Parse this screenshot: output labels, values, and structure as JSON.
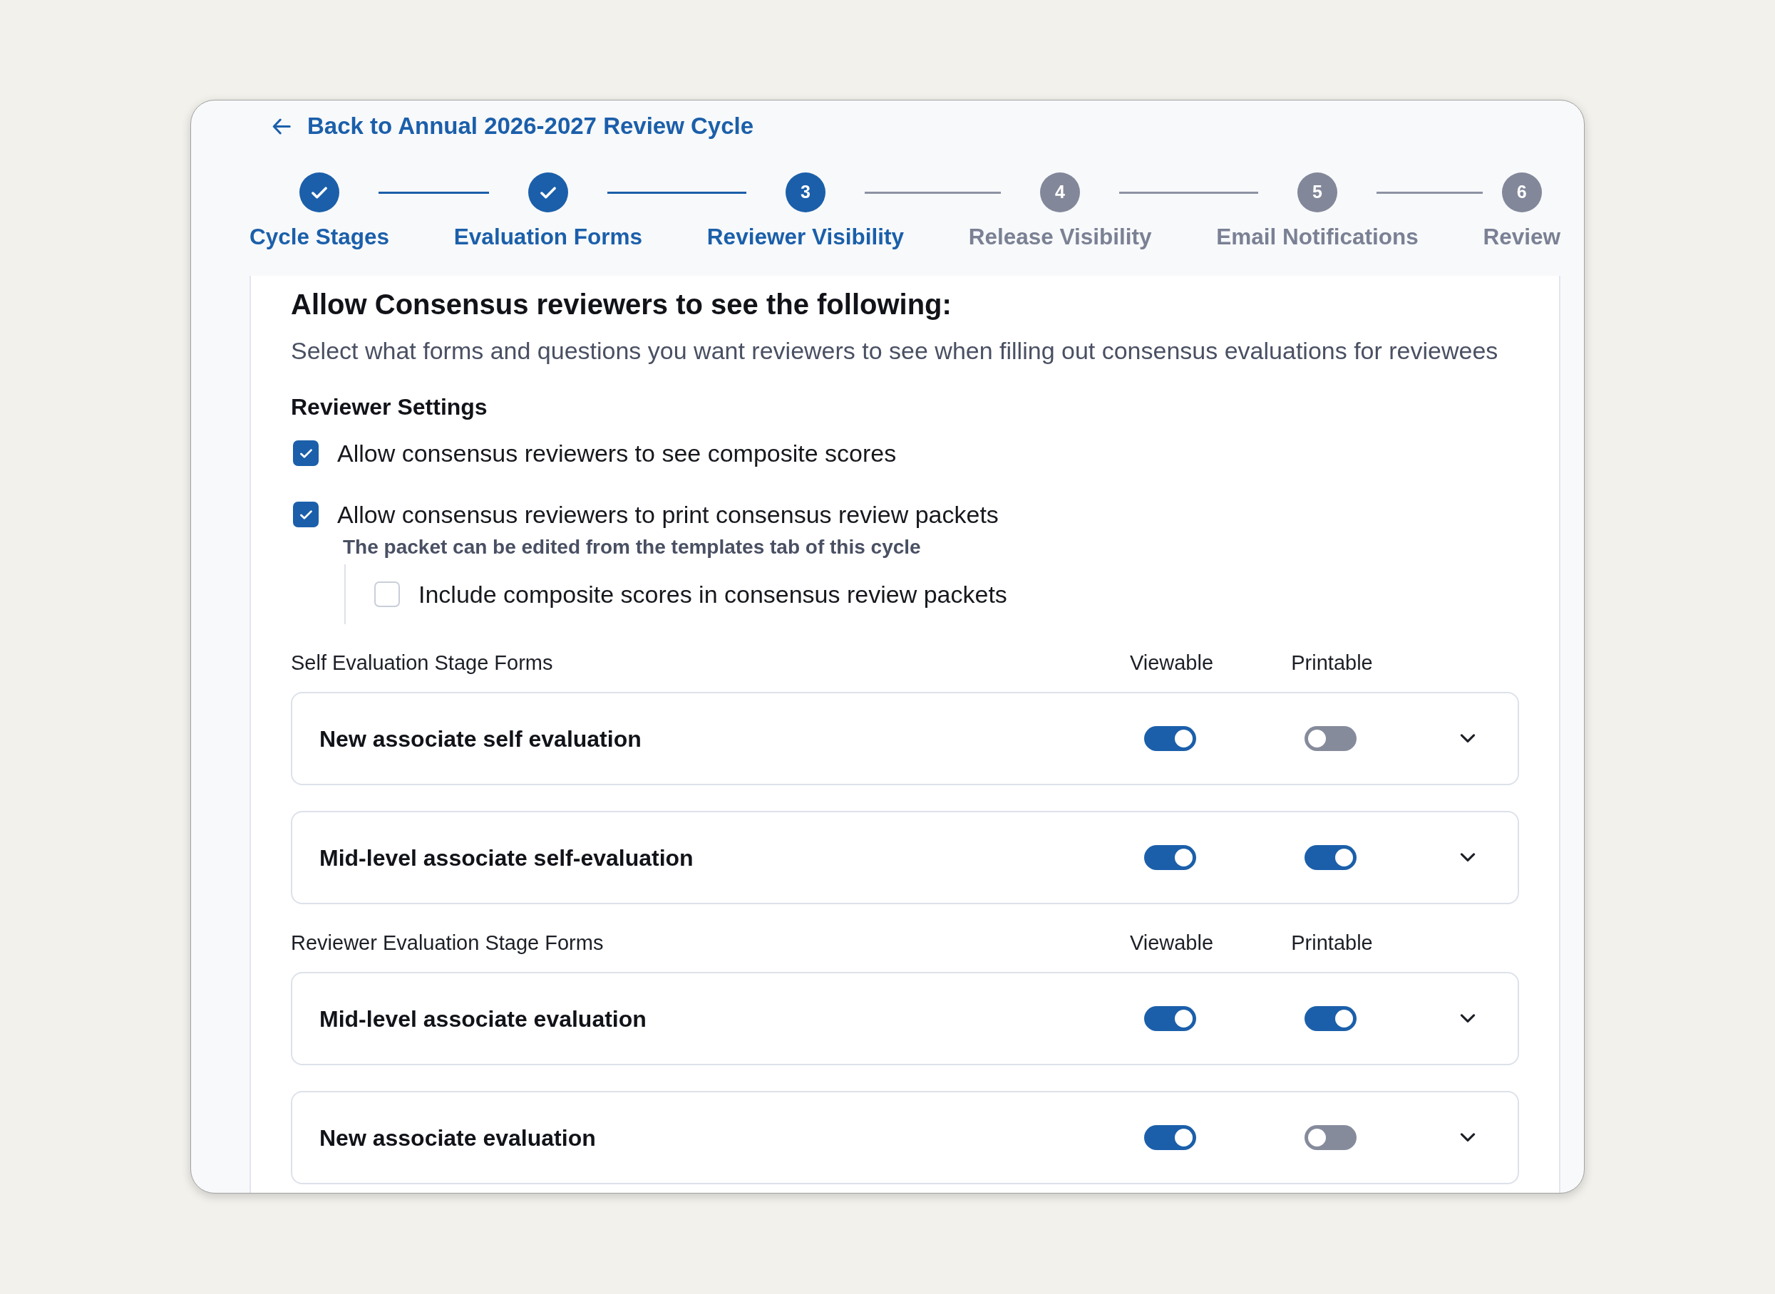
{
  "back_link": {
    "label": "Back to Annual 2026-2027 Review Cycle"
  },
  "stepper": [
    {
      "label": "Cycle Stages",
      "selected": false
    },
    {
      "label": "Evaluation Forms",
      "selected": false
    },
    {
      "label": "Reviewer Visibility",
      "number": "3",
      "selected": true
    },
    {
      "label": "Release Visibility",
      "number": "4",
      "selected": false
    },
    {
      "label": "Email Notifications",
      "number": "5",
      "selected": false
    },
    {
      "label": "Review",
      "number": "6",
      "selected": false
    }
  ],
  "panel": {
    "title": "Allow Consensus reviewers to see the following:",
    "description": "Select what forms and questions you want reviewers to see when filling out consensus evaluations for reviewees"
  },
  "reviewer_settings": {
    "heading": "Reviewer Settings",
    "options": [
      {
        "label": "Allow consensus reviewers to see composite scores",
        "checked": true
      },
      {
        "label": "Allow consensus reviewers to print consensus review packets",
        "checked": true,
        "hint": "The packet can be edited from the templates tab of this cycle",
        "children": [
          {
            "label": "Include composite scores in consensus review packets",
            "checked": false
          }
        ]
      }
    ]
  },
  "form_groups": [
    {
      "heading": "Self Evaluation Stage Forms",
      "columns": [
        "Viewable",
        "Printable"
      ],
      "forms": [
        {
          "name": "New associate self evaluation",
          "viewable": true,
          "printable": false,
          "expanded": false
        },
        {
          "name": "Mid-level associate self-evaluation",
          "viewable": true,
          "printable": true,
          "expanded": false
        }
      ]
    },
    {
      "heading": "Reviewer Evaluation Stage Forms",
      "columns": [
        "Viewable",
        "Printable"
      ],
      "forms": [
        {
          "name": "Mid-level associate evaluation",
          "viewable": true,
          "printable": true,
          "expanded": false
        },
        {
          "name": "New associate evaluation",
          "viewable": true,
          "printable": false,
          "expanded": false
        }
      ]
    }
  ]
}
